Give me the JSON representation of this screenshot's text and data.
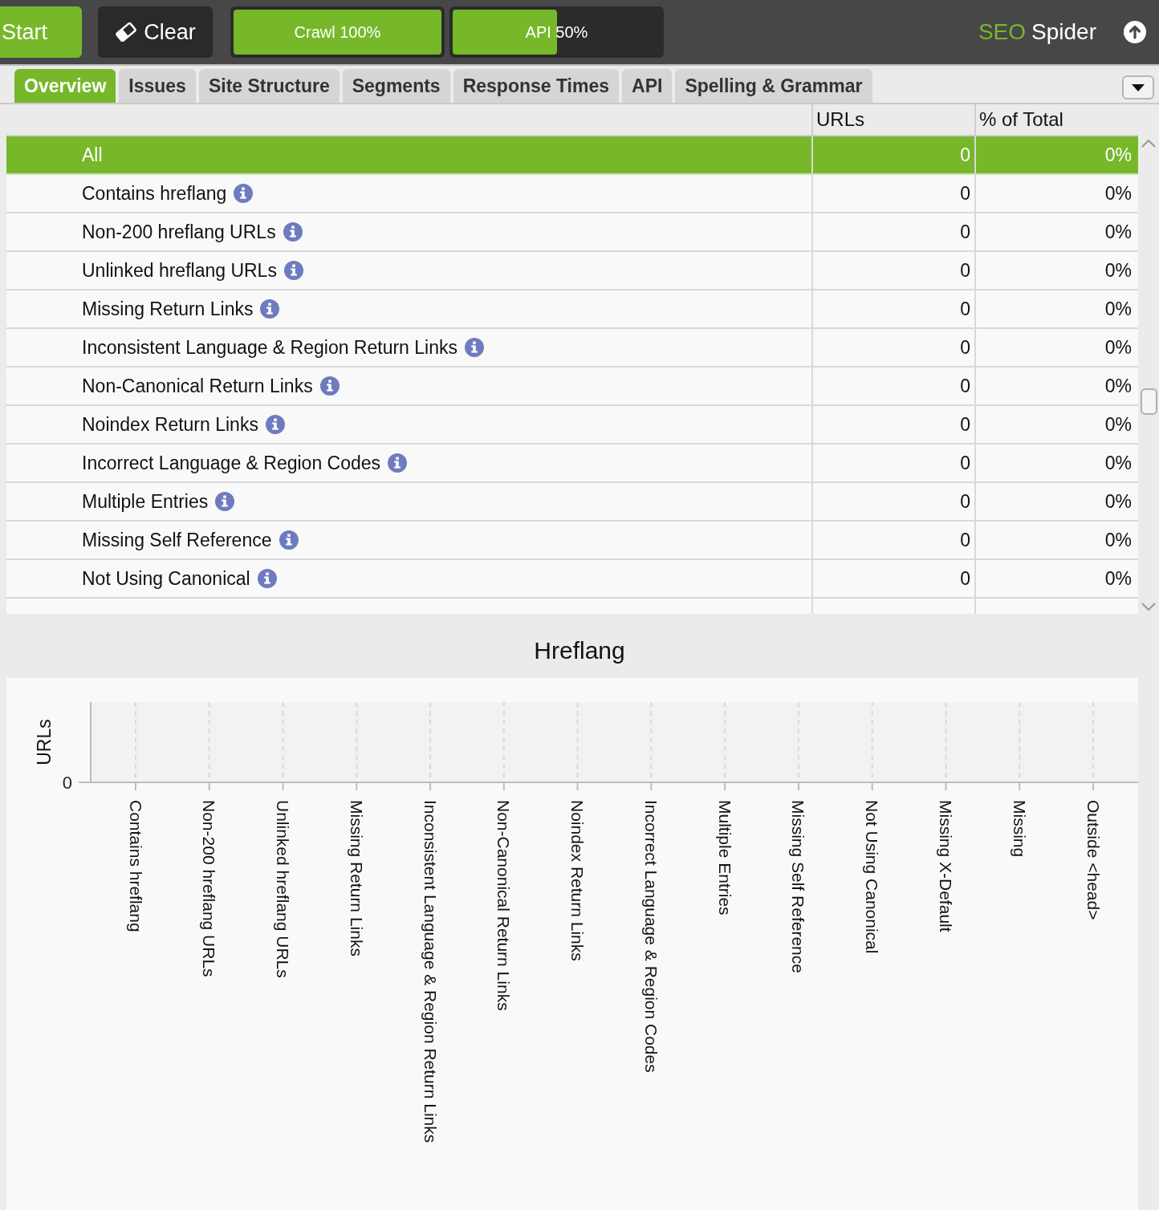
{
  "toolbar": {
    "buttons": [
      {
        "kind": "start",
        "label": "Start"
      },
      {
        "kind": "clear",
        "label": "Clear"
      }
    ],
    "progress": [
      {
        "label": "Crawl 100%",
        "level": 1
      },
      {
        "label": "API 50%",
        "level": 0.5
      }
    ],
    "brand": {
      "accent": "SEO",
      "name": "Spider"
    }
  },
  "tabs": [
    {
      "label": "Overview",
      "selected": true
    },
    {
      "label": "Issues",
      "selected": false
    },
    {
      "label": "Site Structure",
      "selected": false
    },
    {
      "label": "Segments",
      "selected": false
    },
    {
      "label": "Response Times",
      "selected": false
    },
    {
      "label": "API",
      "selected": false
    },
    {
      "label": "Spelling & Grammar",
      "selected": false
    }
  ],
  "table": {
    "columns": [
      "URLs",
      "% of Total"
    ],
    "rows": [
      {
        "label": "All",
        "urls": "0",
        "percent": "0%",
        "selected": true,
        "info": false
      },
      {
        "label": "Contains hreflang",
        "urls": "0",
        "percent": "0%",
        "selected": false,
        "info": true
      },
      {
        "label": "Non-200 hreflang URLs",
        "urls": "0",
        "percent": "0%",
        "selected": false,
        "info": true
      },
      {
        "label": "Unlinked hreflang URLs",
        "urls": "0",
        "percent": "0%",
        "selected": false,
        "info": true
      },
      {
        "label": "Missing Return Links",
        "urls": "0",
        "percent": "0%",
        "selected": false,
        "info": true
      },
      {
        "label": "Inconsistent Language & Region Return Links",
        "urls": "0",
        "percent": "0%",
        "selected": false,
        "info": true
      },
      {
        "label": "Non-Canonical Return Links",
        "urls": "0",
        "percent": "0%",
        "selected": false,
        "info": true
      },
      {
        "label": "Noindex Return Links",
        "urls": "0",
        "percent": "0%",
        "selected": false,
        "info": true
      },
      {
        "label": "Incorrect Language & Region Codes",
        "urls": "0",
        "percent": "0%",
        "selected": false,
        "info": true
      },
      {
        "label": "Multiple Entries",
        "urls": "0",
        "percent": "0%",
        "selected": false,
        "info": true
      },
      {
        "label": "Missing Self Reference",
        "urls": "0",
        "percent": "0%",
        "selected": false,
        "info": true
      },
      {
        "label": "Not Using Canonical",
        "urls": "0",
        "percent": "0%",
        "selected": false,
        "info": true
      }
    ]
  },
  "chart": {
    "title": "Hreflang",
    "y_axis_title": "URLs",
    "y_tick": "0",
    "categories": [
      "Contains hreflang",
      "Non-200 hreflang URLs",
      "Unlinked hreflang URLs",
      "Missing Return Links",
      "Inconsistent Language & Region Return Links",
      "Non-Canonical Return Links",
      "Noindex Return Links",
      "Incorrect Language & Region Codes",
      "Multiple Entries",
      "Missing Self Reference",
      "Not Using Canonical",
      "Missing X-Default",
      "Missing",
      "Outside <head>"
    ]
  }
}
